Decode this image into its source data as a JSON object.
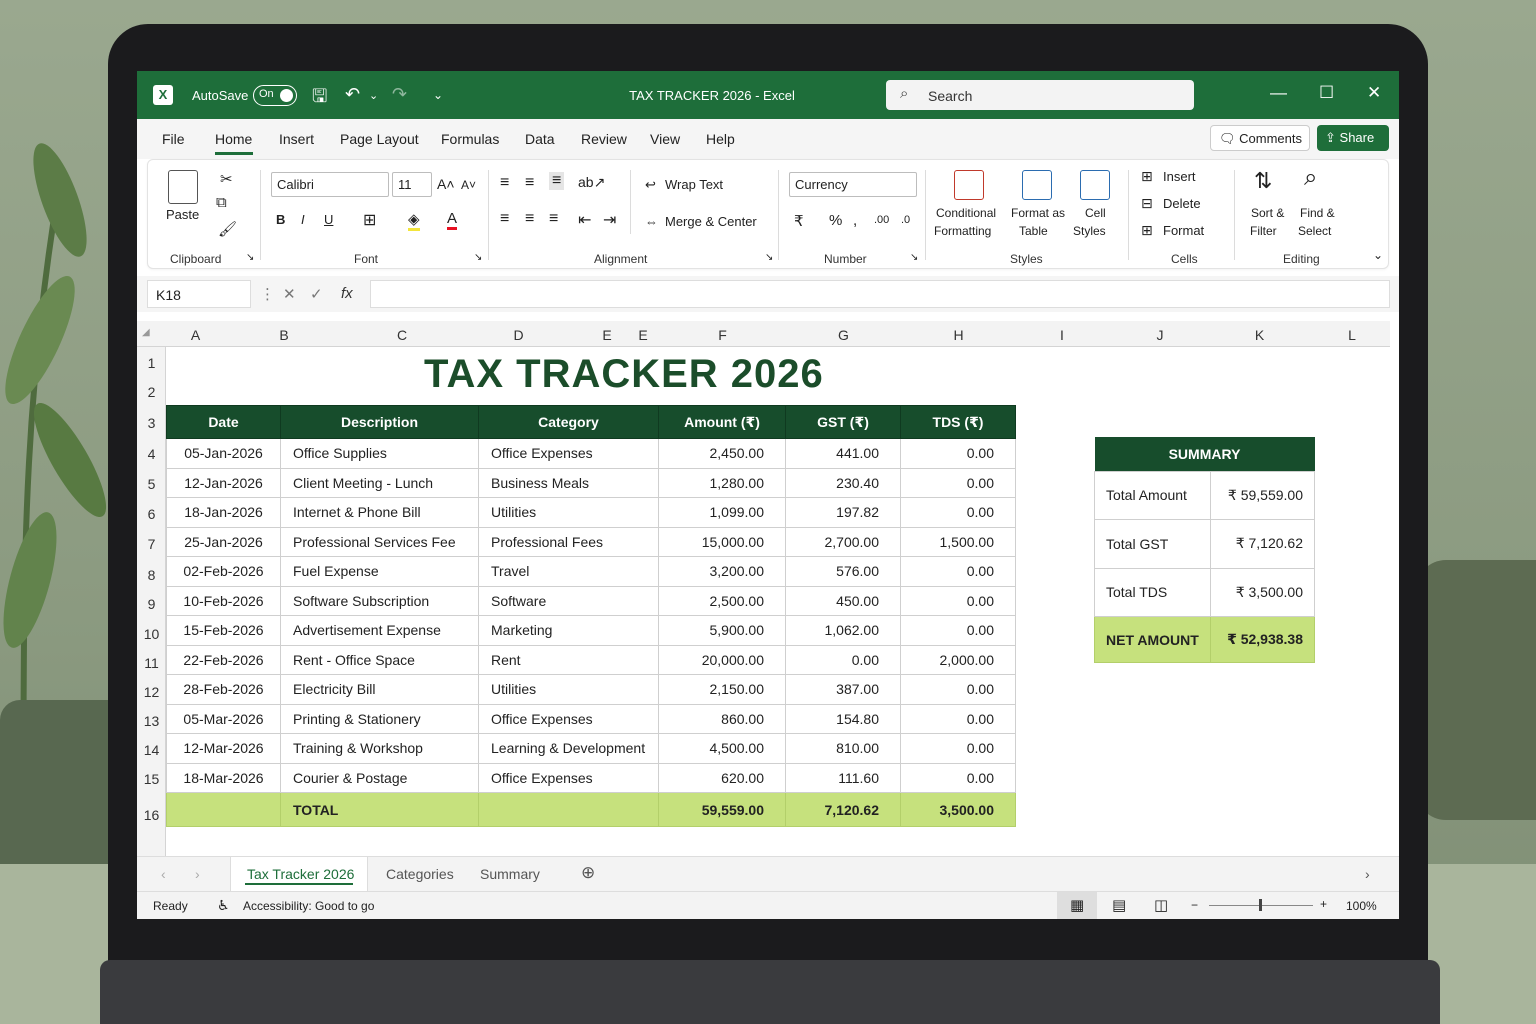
{
  "app": {
    "autosave_label": "AutoSave",
    "autosave_state": "On",
    "title": "TAX TRACKER 2026  -  Excel",
    "search_placeholder": "Search"
  },
  "menu": {
    "items": [
      "File",
      "Home",
      "Insert",
      "Page Layout",
      "Formulas",
      "Data",
      "Review",
      "View",
      "Help"
    ],
    "comments": "Comments",
    "share": "Share"
  },
  "ribbon": {
    "clipboard": {
      "paste": "Paste",
      "label": "Clipboard"
    },
    "font": {
      "name": "Calibri",
      "size": "11",
      "label": "Font"
    },
    "alignment": {
      "wrap": "Wrap Text",
      "merge": "Merge & Center",
      "label": "Alignment"
    },
    "number": {
      "format": "Currency",
      "label": "Number"
    },
    "styles": {
      "conditional": "Conditional",
      "conditional2": "Formatting",
      "format_as": "Format as",
      "table": "Table",
      "cell": "Cell",
      "cell_styles": "Styles",
      "label": "Styles"
    },
    "cells": {
      "insert": "Insert",
      "delete": "Delete",
      "format": "Format",
      "label": "Cells"
    },
    "editing": {
      "sort": "Sort &",
      "filter": "Filter",
      "find": "Find &",
      "select": "Select",
      "label": "Editing"
    }
  },
  "formula_bar": {
    "name_box": "K18",
    "fx": "fx"
  },
  "columns": [
    "A",
    "B",
    "C",
    "D",
    "E",
    "E",
    "F",
    "G",
    "H",
    "I",
    "J",
    "K",
    "L"
  ],
  "rows": [
    "1",
    "2",
    "3",
    "4",
    "5",
    "6",
    "7",
    "8",
    "9",
    "10",
    "11",
    "12",
    "13",
    "14",
    "15",
    "16"
  ],
  "sheet": {
    "title": "TAX TRACKER 2026",
    "headers": [
      "Date",
      "Description",
      "Category",
      "Amount (₹)",
      "GST (₹)",
      "TDS (₹)"
    ],
    "entries": [
      [
        "05-Jan-2026",
        "Office Supplies",
        "Office Expenses",
        "2,450.00",
        "441.00",
        "0.00"
      ],
      [
        "12-Jan-2026",
        "Client Meeting - Lunch",
        "Business Meals",
        "1,280.00",
        "230.40",
        "0.00"
      ],
      [
        "18-Jan-2026",
        "Internet & Phone Bill",
        "Utilities",
        "1,099.00",
        "197.82",
        "0.00"
      ],
      [
        "25-Jan-2026",
        "Professional Services Fee",
        "Professional Fees",
        "15,000.00",
        "2,700.00",
        "1,500.00"
      ],
      [
        "02-Feb-2026",
        "Fuel Expense",
        "Travel",
        "3,200.00",
        "576.00",
        "0.00"
      ],
      [
        "10-Feb-2026",
        "Software Subscription",
        "Software",
        "2,500.00",
        "450.00",
        "0.00"
      ],
      [
        "15-Feb-2026",
        "Advertisement Expense",
        "Marketing",
        "5,900.00",
        "1,062.00",
        "0.00"
      ],
      [
        "22-Feb-2026",
        "Rent - Office Space",
        "Rent",
        "20,000.00",
        "0.00",
        "2,000.00"
      ],
      [
        "28-Feb-2026",
        "Electricity Bill",
        "Utilities",
        "2,150.00",
        "387.00",
        "0.00"
      ],
      [
        "05-Mar-2026",
        "Printing & Stationery",
        "Office Expenses",
        "860.00",
        "154.80",
        "0.00"
      ],
      [
        "12-Mar-2026",
        "Training & Workshop",
        "Learning & Development",
        "4,500.00",
        "810.00",
        "0.00"
      ],
      [
        "18-Mar-2026",
        "Courier & Postage",
        "Office Expenses",
        "620.00",
        "111.60",
        "0.00"
      ]
    ],
    "total": {
      "label": "TOTAL",
      "amount": "59,559.00",
      "gst": "7,120.62",
      "tds": "3,500.00"
    }
  },
  "summary": {
    "title": "SUMMARY",
    "rows": [
      [
        "Total Amount",
        "₹ 59,559.00"
      ],
      [
        "Total GST",
        "₹ 7,120.62"
      ],
      [
        "Total TDS",
        "₹ 3,500.00"
      ]
    ],
    "net_label": "NET AMOUNT",
    "net_value": "₹ 52,938.38"
  },
  "tabs": [
    "Tax Tracker 2026",
    "Categories",
    "Summary"
  ],
  "status": {
    "ready": "Ready",
    "accessibility": "Accessibility: Good to go",
    "zoom": "100%"
  },
  "colors": {
    "excel_green": "#1e6e3a",
    "header_green": "#174d2c",
    "total_lime": "#c6e17d"
  }
}
